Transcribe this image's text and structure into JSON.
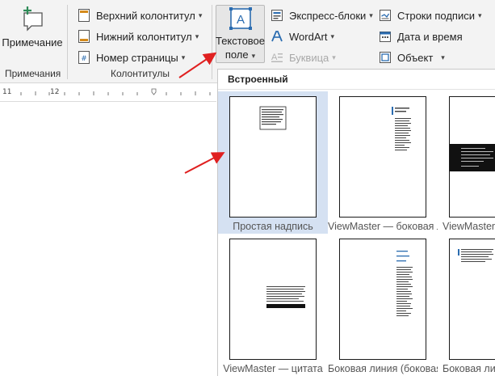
{
  "ribbon": {
    "comment_group": {
      "button_label": "Примечание",
      "group_label": "Примечания"
    },
    "header_footer_group": {
      "header_label": "Верхний колонтитул",
      "footer_label": "Нижний колонтитул",
      "page_number_label": "Номер страницы",
      "group_label": "Колонтитулы"
    },
    "text_group": {
      "text_box_line1": "Текстовое",
      "text_box_line2": "поле",
      "quick_parts_label": "Экспресс-блоки",
      "wordart_label": "WordArt",
      "dropcap_label": "Буквица",
      "signature_line_label": "Строки подписи",
      "date_time_label": "Дата и время",
      "object_label": "Объект"
    }
  },
  "ruler": {
    "label_11": "11",
    "label_12": "12"
  },
  "gallery": {
    "header": "Встроенный",
    "tiles": [
      {
        "label": "Простая надпись"
      },
      {
        "label": "ViewMaster — боковая линия"
      },
      {
        "label": "ViewMaster — боковая"
      },
      {
        "label": "ViewMaster — цитата"
      },
      {
        "label": "Боковая линия (боковая)"
      },
      {
        "label": "Боковая линия"
      }
    ]
  },
  "colors": {
    "accent_blue": "#2b6cb0",
    "selected_tile": "#d5e1f2",
    "arrow_red": "#e02020"
  }
}
